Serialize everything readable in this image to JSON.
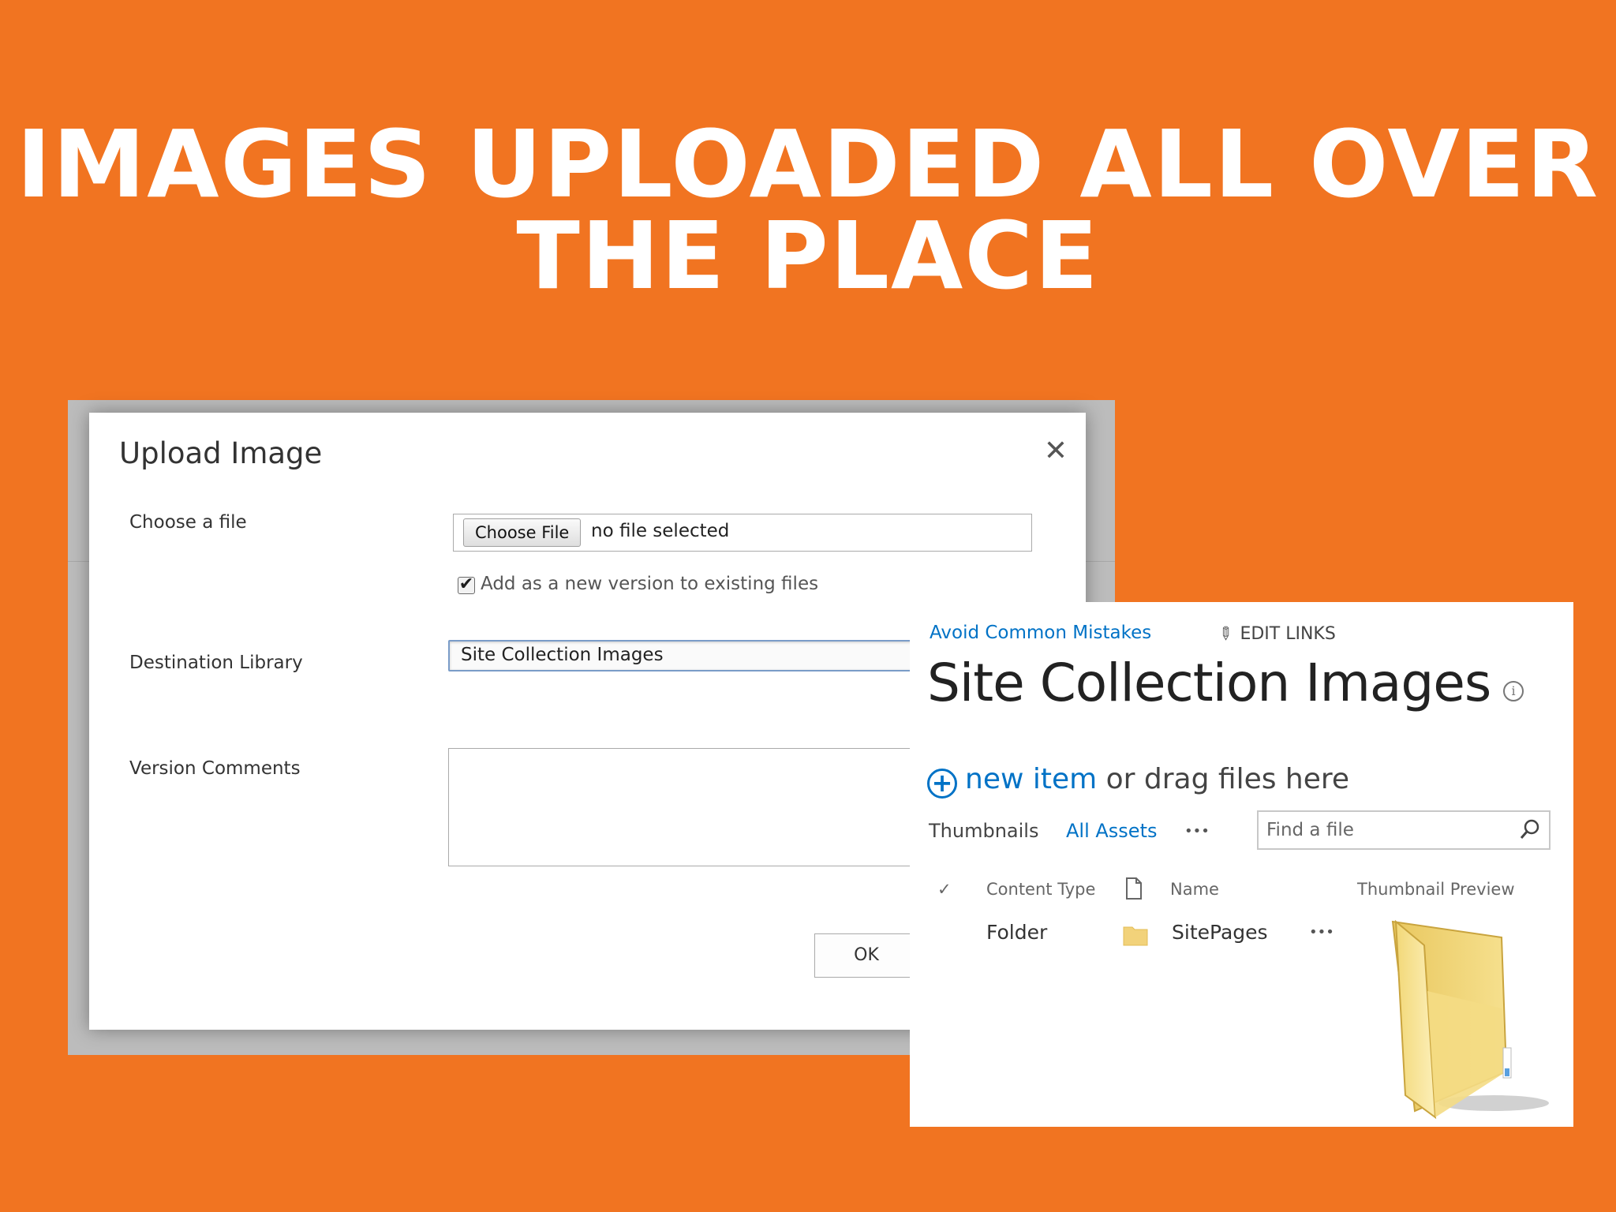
{
  "headline": {
    "line1": "IMAGES UPLOADED ALL OVER",
    "line2": "THE PLACE"
  },
  "upload_dialog": {
    "title": "Upload Image",
    "close_icon": "close-icon",
    "choose_file_label": "Choose a file",
    "choose_file_button": "Choose File",
    "file_status": "no file selected",
    "new_version_checkbox_label": "Add as a new version to existing files",
    "new_version_checked": true,
    "destination_label": "Destination Library",
    "destination_value": "Site Collection Images",
    "version_comments_label": "Version Comments",
    "version_comments_value": "",
    "ok_button": "OK"
  },
  "library": {
    "breadcrumb": "Avoid Common Mistakes",
    "edit_links": "EDIT LINKS",
    "title": "Site Collection Images",
    "new_item_link": "new item",
    "drag_text": " or drag files here",
    "views": {
      "thumbnails": "Thumbnails",
      "all_assets": "All Assets",
      "more": "•••"
    },
    "search_placeholder": "Find a file",
    "columns": {
      "content_type": "Content Type",
      "name": "Name",
      "thumbnail_preview": "Thumbnail Preview"
    },
    "rows": [
      {
        "content_type": "Folder",
        "name": "SitePages",
        "menu": "•••"
      }
    ],
    "colors": {
      "link": "#0072c6",
      "folder": "#F2D27A"
    }
  },
  "colors": {
    "background": "#F17421",
    "headline": "#ffffff"
  }
}
